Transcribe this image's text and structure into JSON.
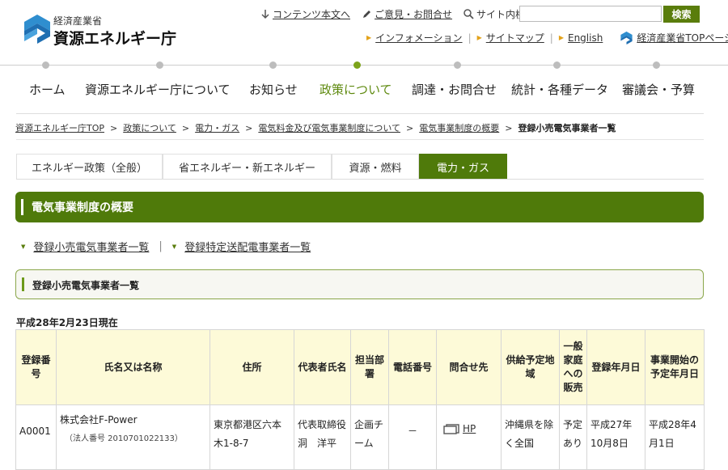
{
  "header": {
    "logo_sub": "経済産業省",
    "logo_main": "資源エネルギー庁",
    "util_links": [
      {
        "label": "コンテンツ本文へ",
        "icon": "download-arrow-icon"
      },
      {
        "label": "ご意見・お問合せ",
        "icon": "pencil-icon"
      }
    ],
    "search_label": "サイト内検索",
    "search_value": "",
    "search_button": "検索",
    "sub_links": [
      "インフォメーション",
      "サイトマップ",
      "English"
    ],
    "meti_link": "経済産業省TOPページ"
  },
  "nav": {
    "items": [
      "ホーム",
      "資源エネルギー庁について",
      "お知らせ",
      "政策について",
      "調達・お問合せ",
      "統計・各種データ",
      "審議会・予算"
    ],
    "active_index": 3
  },
  "breadcrumb": {
    "links": [
      "資源エネルギー庁TOP",
      "政策について",
      "電力・ガス",
      "電気料金及び電気事業制度について",
      "電気事業制度の概要"
    ],
    "current": "登録小売電気事業者一覧"
  },
  "tabs": {
    "items": [
      "エネルギー政策（全般）",
      "省エネルギー・新エネルギー",
      "資源・燃料",
      "電力・ガス"
    ],
    "active_index": 3
  },
  "section": {
    "title": "電気事業制度の概要",
    "anchor_links": [
      "登録小売電気事業者一覧",
      "登録特定送配電事業者一覧"
    ],
    "subheading": "登録小売電気事業者一覧"
  },
  "table": {
    "as_of": "平成28年2月23日現在",
    "headers": [
      "登録番号",
      "氏名又は名称",
      "住所",
      "代表者氏名",
      "担当部署",
      "電話番号",
      "問合せ先",
      "供給予定地域",
      "一般家庭への販売",
      "登録年月日",
      "事業開始の予定年月日"
    ],
    "rows": [
      {
        "reg_no": "A0001",
        "name": "株式会社F-Power",
        "corp_number": "（法人番号 2010701022133）",
        "address": "東京都港区六本木1-8-7",
        "representative": "代表取締役　洞　洋平",
        "department": "企画チーム",
        "phone": "－",
        "contact": "HP",
        "supply_area": "沖縄県を除く全国",
        "household_sales": "予定あり",
        "reg_date": "平成27年10月8日",
        "start_date": "平成28年4月1日"
      }
    ]
  },
  "colors": {
    "brand_green": "#4f7a0a",
    "nav_active": "#5f8a10",
    "header_cell_bg": "#fdfad8",
    "link_triangle": "#e3a21a"
  }
}
